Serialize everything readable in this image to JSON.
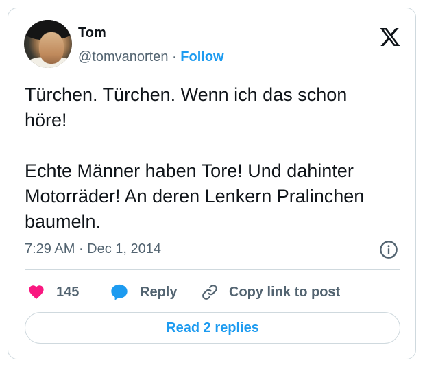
{
  "author": {
    "name": "Tom",
    "handle": "@tomvanorten",
    "separator": " · ",
    "follow_label": "Follow"
  },
  "tweet": {
    "text": "Türchen. Türchen. Wenn ich das schon\nhöre!\n\nEchte Männer haben Tore! Und dahinter\nMotorräder! An deren Lenkern Pralinchen\nbaumeln."
  },
  "meta": {
    "time": "7:29 AM",
    "separator": " · ",
    "date": "Dec 1, 2014"
  },
  "actions": {
    "like_count": "145",
    "reply_label": "Reply",
    "copy_label": "Copy link to post"
  },
  "read_replies_label": "Read 2 replies",
  "colors": {
    "accent": "#1d9bf0",
    "like": "#f91880",
    "text": "#0f1419",
    "secondary": "#536471",
    "border": "#cfd9de"
  },
  "icons": [
    "x-logo-icon",
    "info-icon",
    "heart-icon",
    "reply-bubble-icon",
    "link-icon"
  ]
}
